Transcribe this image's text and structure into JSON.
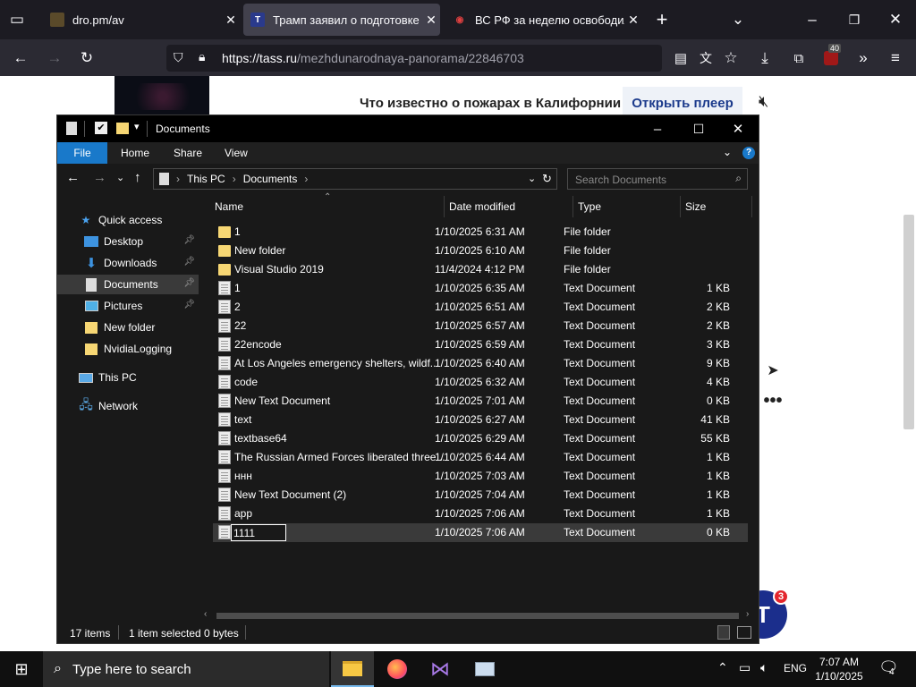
{
  "browser": {
    "tabs": [
      {
        "title": "dro.pm/av",
        "active": false
      },
      {
        "title": "Трамп заявил о подготовке вс",
        "active": true
      },
      {
        "title": "ВС РФ за неделю освободили",
        "active": false
      }
    ],
    "url_host": "https://tass.ru",
    "url_path": "/mezhdunarodnaya-panorama/22846703",
    "extensions_badge": "40"
  },
  "webpage": {
    "banner_text": "Что известно о пожарах в Калифорнии",
    "player_button": "Открыть плеер",
    "logo_letter": "T",
    "logo_badge": "3"
  },
  "explorer": {
    "title": "Documents",
    "ribbon_tabs": [
      "File",
      "Home",
      "Share",
      "View"
    ],
    "breadcrumbs": [
      "This PC",
      "Documents"
    ],
    "search_placeholder": "Search Documents",
    "columns": {
      "name": "Name",
      "date": "Date modified",
      "type": "Type",
      "size": "Size"
    },
    "nav": {
      "quick_access": "Quick access",
      "items": [
        "Desktop",
        "Downloads",
        "Documents",
        "Pictures",
        "New folder",
        "NvidiaLogging"
      ],
      "this_pc": "This PC",
      "network": "Network"
    },
    "files": [
      {
        "name": "1",
        "date": "1/10/2025 6:31 AM",
        "type": "File folder",
        "size": "",
        "kind": "folder"
      },
      {
        "name": "New folder",
        "date": "1/10/2025 6:10 AM",
        "type": "File folder",
        "size": "",
        "kind": "folder"
      },
      {
        "name": "Visual Studio 2019",
        "date": "11/4/2024 4:12 PM",
        "type": "File folder",
        "size": "",
        "kind": "folder"
      },
      {
        "name": "1",
        "date": "1/10/2025 6:35 AM",
        "type": "Text Document",
        "size": "1 KB",
        "kind": "doc"
      },
      {
        "name": "2",
        "date": "1/10/2025 6:51 AM",
        "type": "Text Document",
        "size": "2 KB",
        "kind": "doc"
      },
      {
        "name": "22",
        "date": "1/10/2025 6:57 AM",
        "type": "Text Document",
        "size": "2 KB",
        "kind": "doc"
      },
      {
        "name": "22encode",
        "date": "1/10/2025 6:59 AM",
        "type": "Text Document",
        "size": "3 KB",
        "kind": "doc"
      },
      {
        "name": "At Los Angeles emergency shelters, wildf...",
        "date": "1/10/2025 6:40 AM",
        "type": "Text Document",
        "size": "9 KB",
        "kind": "doc"
      },
      {
        "name": "code",
        "date": "1/10/2025 6:32 AM",
        "type": "Text Document",
        "size": "4 KB",
        "kind": "doc"
      },
      {
        "name": "New Text Document",
        "date": "1/10/2025 7:01 AM",
        "type": "Text Document",
        "size": "0 KB",
        "kind": "doc"
      },
      {
        "name": "text",
        "date": "1/10/2025 6:27 AM",
        "type": "Text Document",
        "size": "41 KB",
        "kind": "doc"
      },
      {
        "name": "textbase64",
        "date": "1/10/2025 6:29 AM",
        "type": "Text Document",
        "size": "55 KB",
        "kind": "doc"
      },
      {
        "name": "The Russian Armed Forces liberated three...",
        "date": "1/10/2025 6:44 AM",
        "type": "Text Document",
        "size": "1 KB",
        "kind": "doc"
      },
      {
        "name": "ннн",
        "date": "1/10/2025 7:03 AM",
        "type": "Text Document",
        "size": "1 KB",
        "kind": "doc"
      },
      {
        "name": "New Text Document (2)",
        "date": "1/10/2025 7:04 AM",
        "type": "Text Document",
        "size": "1 KB",
        "kind": "doc"
      },
      {
        "name": "app",
        "date": "1/10/2025 7:06 AM",
        "type": "Text Document",
        "size": "1 KB",
        "kind": "doc"
      }
    ],
    "renaming_file": {
      "value": "1111",
      "date": "1/10/2025 7:06 AM",
      "type": "Text Document",
      "size": "0 KB"
    },
    "status": {
      "count": "17 items",
      "selected": "1 item selected",
      "size": "0 bytes"
    }
  },
  "taskbar": {
    "search_placeholder": "Type here to search",
    "language": "ENG",
    "time": "7:07 AM",
    "date": "1/10/2025",
    "notification_count": "4"
  }
}
